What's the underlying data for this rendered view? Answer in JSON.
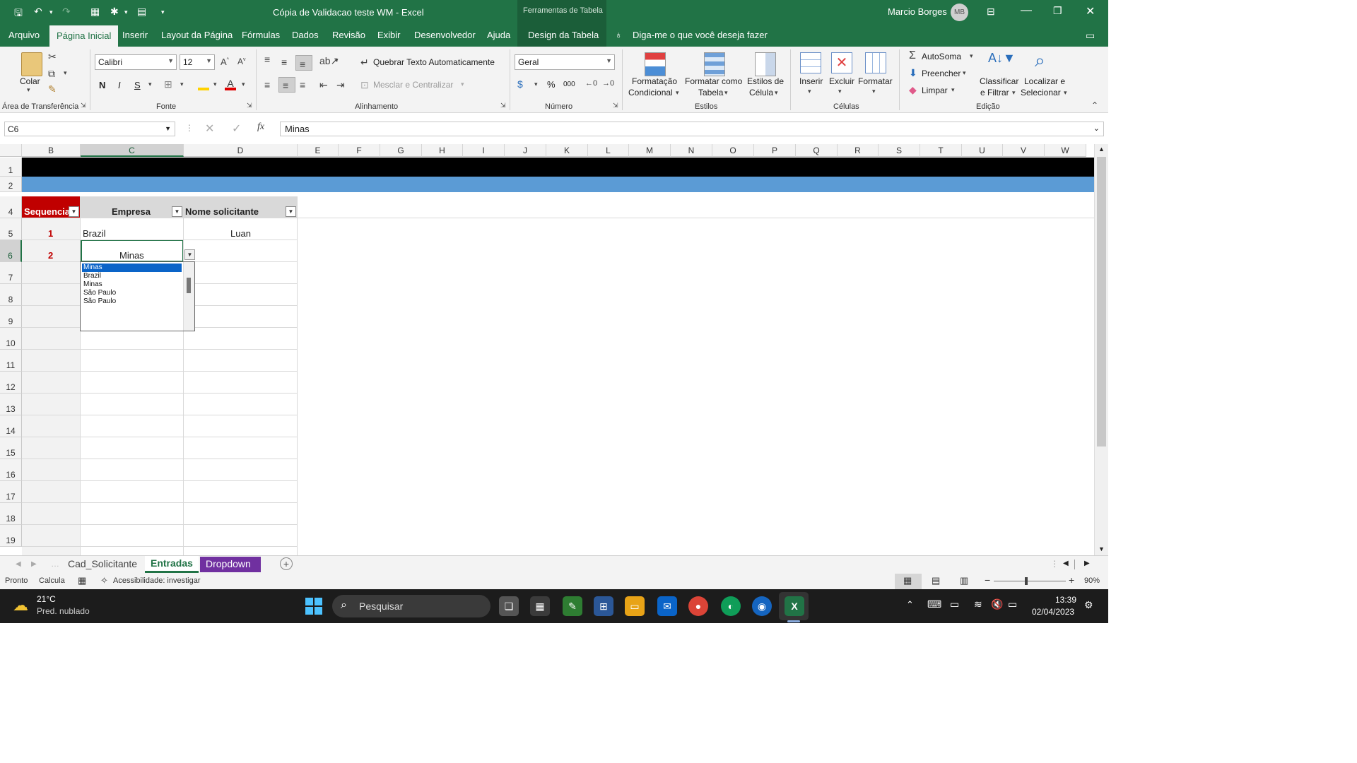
{
  "titlebar": {
    "title": "Cópia de Validacao teste WM  -  Excel",
    "context_tools": "Ferramentas de Tabela",
    "user_name": "Marcio Borges",
    "user_initials": "MB"
  },
  "ribbon_tabs": [
    "Arquivo",
    "Página Inicial",
    "Inserir",
    "Layout da Página",
    "Fórmulas",
    "Dados",
    "Revisão",
    "Exibir",
    "Desenvolvedor",
    "Ajuda",
    "Design da Tabela"
  ],
  "tell_me": "Diga-me o que você deseja fazer",
  "ribbon": {
    "clipboard": {
      "paste": "Colar",
      "label": "Área de Transferência"
    },
    "font": {
      "name": "Calibri",
      "size": "12",
      "bold": "N",
      "italic": "I",
      "underline": "S",
      "label": "Fonte"
    },
    "alignment": {
      "wrap": "Quebrar Texto Automaticamente",
      "merge": "Mesclar e Centralizar",
      "label": "Alinhamento"
    },
    "number": {
      "format": "Geral",
      "percent": "%",
      "thousands": "000",
      "label": "Número"
    },
    "styles": {
      "conditional_1": "Formatação",
      "conditional_2": "Condicional",
      "table_1": "Formatar como",
      "table_2": "Tabela",
      "cell_1": "Estilos de",
      "cell_2": "Célula",
      "label": "Estilos"
    },
    "cells": {
      "insert": "Inserir",
      "delete": "Excluir",
      "format": "Formatar",
      "label": "Células"
    },
    "editing": {
      "autosum": "AutoSoma",
      "fill": "Preencher",
      "clear": "Limpar",
      "sort_1": "Classificar",
      "sort_2": "e Filtrar",
      "find_1": "Localizar e",
      "find_2": "Selecionar",
      "label": "Edição"
    }
  },
  "formula_bar": {
    "name_box": "C6",
    "fx": "fx",
    "content": "Minas"
  },
  "columns": [
    "B",
    "C",
    "D",
    "E",
    "F",
    "G",
    "H",
    "I",
    "J",
    "K",
    "L",
    "M",
    "N",
    "O",
    "P",
    "Q",
    "R",
    "S",
    "T",
    "U",
    "V",
    "W"
  ],
  "rows": [
    "1",
    "2",
    "4",
    "5",
    "6",
    "7",
    "8",
    "9",
    "10",
    "11",
    "12",
    "13",
    "14",
    "15",
    "16",
    "17",
    "18",
    "19"
  ],
  "table": {
    "headers": [
      "Sequencia",
      "Empresa",
      "Nome solicitante"
    ],
    "data": [
      {
        "seq": "1",
        "empresa": "Brazil",
        "nome": "Luan"
      },
      {
        "seq": "2",
        "empresa": "Minas",
        "nome": ""
      }
    ]
  },
  "dropdown": {
    "options": [
      "Minas",
      "Brazil",
      "Minas",
      "São Paulo",
      "São Paulo"
    ]
  },
  "sheets": [
    "Cad_Solicitante",
    "Entradas",
    "Dropdown"
  ],
  "statusbar": {
    "ready": "Pronto",
    "calc": "Calcula",
    "accessibility": "Acessibilidade: investigar",
    "zoom": "90%"
  },
  "taskbar": {
    "temp": "21°C",
    "weather": "Pred. nublado",
    "search": "Pesquisar",
    "time": "13:39",
    "date": "02/04/2023"
  },
  "colors": {
    "excel_green": "#217346",
    "header_red": "#c00000",
    "band_blue": "#5b9bd5",
    "sheet_purple": "#7030a0"
  }
}
